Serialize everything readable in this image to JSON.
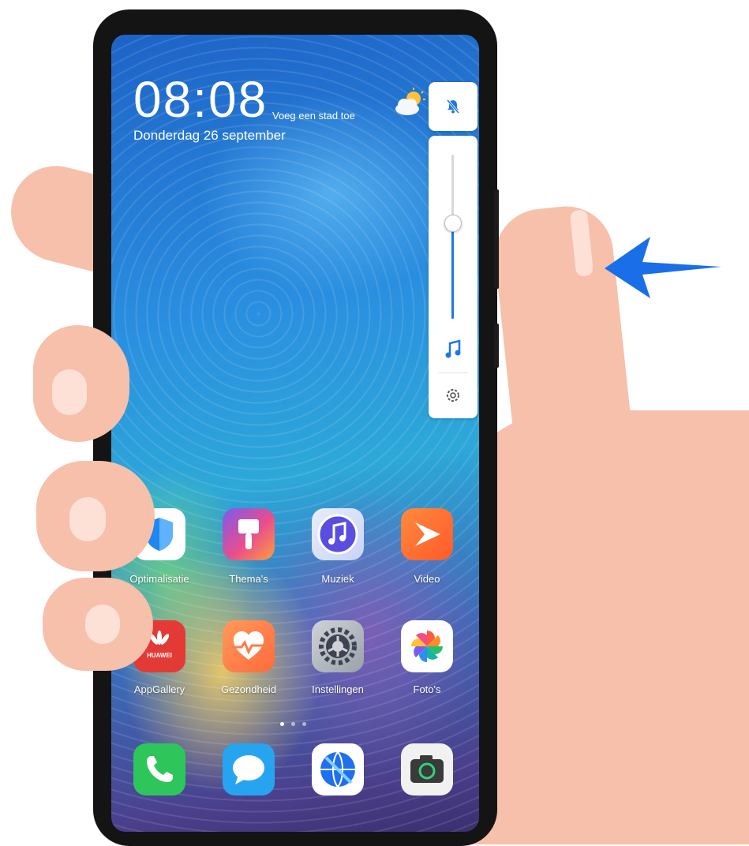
{
  "status": {
    "time": "08:08",
    "location_hint": "Voeg een stad toe",
    "date": "Donderdag 26 september"
  },
  "volume_panel": {
    "ring_mode_icon": "bell-off-icon",
    "level": 0.59,
    "stream_icon": "music-note-icon",
    "settings_icon": "gear-icon",
    "accent": "#1e77e8"
  },
  "apps": [
    {
      "label": "Optimalisatie",
      "icon": "shield-icon"
    },
    {
      "label": "Thema's",
      "icon": "paintbrush-icon"
    },
    {
      "label": "Muziek",
      "icon": "music-icon"
    },
    {
      "label": "Video",
      "icon": "play-icon"
    },
    {
      "label": "AppGallery",
      "icon": "huawei-logo-icon",
      "logo_text": "HUAWEI"
    },
    {
      "label": "Gezondheid",
      "icon": "heart-icon"
    },
    {
      "label": "Instellingen",
      "icon": "gear-icon"
    },
    {
      "label": "Foto's",
      "icon": "pinwheel-icon"
    }
  ],
  "dock": [
    {
      "icon": "phone-icon"
    },
    {
      "icon": "message-icon"
    },
    {
      "icon": "browser-icon"
    },
    {
      "icon": "camera-icon"
    }
  ],
  "page_indicator": {
    "count": 3,
    "active": 1
  },
  "gesture": {
    "arrow_icon": "arrow-left-icon",
    "arrow_color": "#1a6fe8"
  }
}
